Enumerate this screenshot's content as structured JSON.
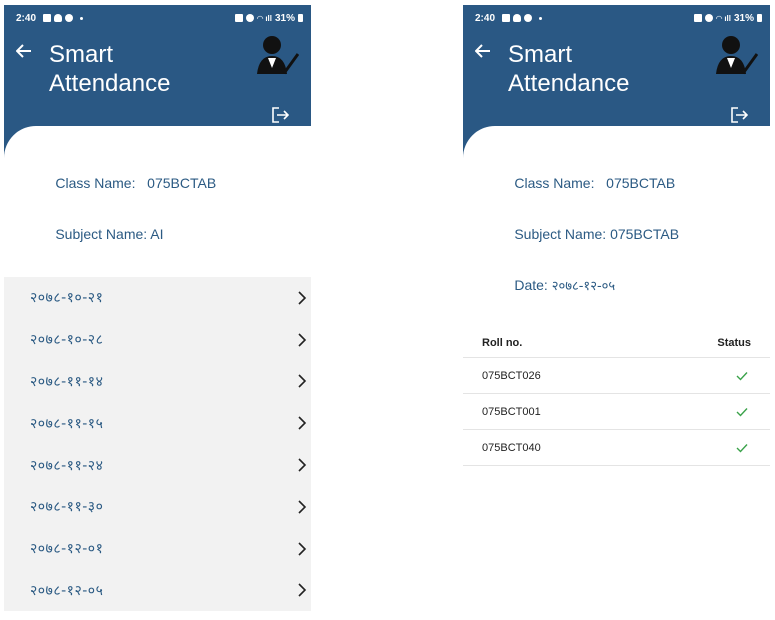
{
  "colors": {
    "primary": "#2a5884",
    "text_blue": "#2b5a83",
    "list_bg": "#f2f2f2",
    "check_green": "#3aa24a"
  },
  "status_bar": {
    "time": "2:40",
    "battery": "31%"
  },
  "app": {
    "title": "Smart Attendance",
    "back_icon": "back-arrow-icon",
    "user_icon": "teacher-user-icon",
    "logout_icon": "logout-icon"
  },
  "screen1": {
    "class_label": "Class Name:",
    "class_value": "075BCTAB",
    "subject_label": "Subject Name:",
    "subject_value": "AI",
    "dates": [
      "२०७८-१०-२१",
      "२०७८-१०-२८",
      "२०७८-११-१४",
      "२०७८-११-१५",
      "२०७८-११-२४",
      "२०७८-११-३०",
      "२०७८-१२-०१",
      "२०७८-१२-०५"
    ]
  },
  "screen2": {
    "class_label": "Class Name:",
    "class_value": "075BCTAB",
    "subject_label": "Subject Name:",
    "subject_value": "075BCTAB",
    "date_label": "Date:",
    "date_value": "२०७८-१२-०५",
    "columns": {
      "roll": "Roll no.",
      "status": "Status"
    },
    "rows": [
      {
        "roll": "075BCT026",
        "status": "present"
      },
      {
        "roll": "075BCT001",
        "status": "present"
      },
      {
        "roll": "075BCT040",
        "status": "present"
      }
    ]
  }
}
